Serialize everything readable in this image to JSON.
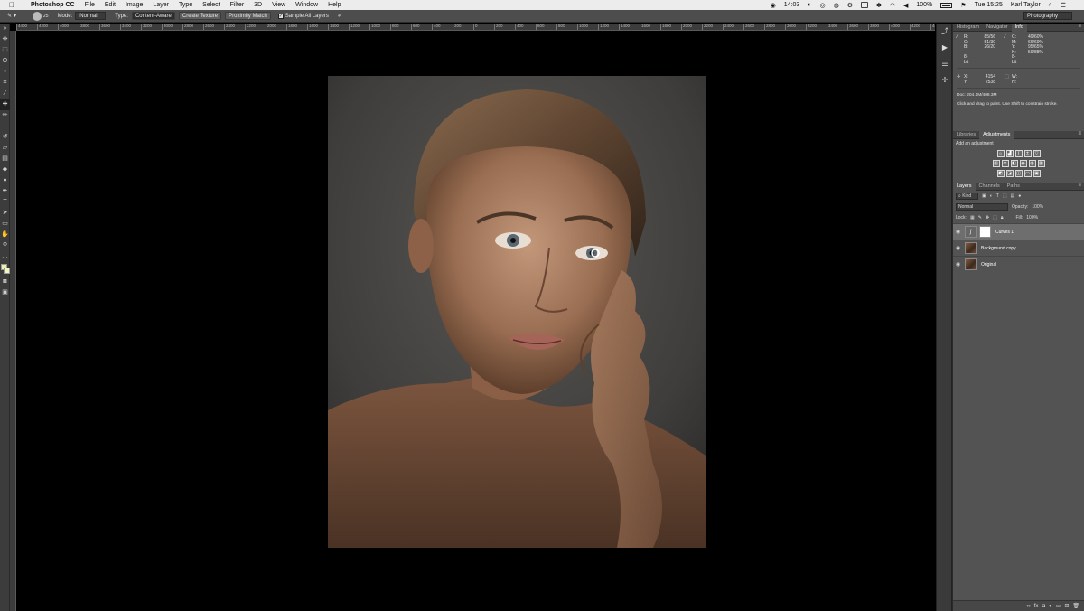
{
  "menubar": {
    "apple": "",
    "app_name": "Photoshop CC",
    "menus": [
      "File",
      "Edit",
      "Image",
      "Layer",
      "Type",
      "Select",
      "Filter",
      "3D",
      "View",
      "Window",
      "Help"
    ],
    "time_left": "14:03",
    "battery": "100%",
    "clock": "Tue 15:25",
    "user": "Karl Taylor"
  },
  "options": {
    "brush_size": "25",
    "mode_label": "Mode:",
    "mode_value": "Normal",
    "type_label": "Type:",
    "content_aware": "Content-Aware",
    "create_texture": "Create Texture",
    "proximity_match": "Proximity Match",
    "sample_all_layers": "Sample All Layers",
    "workspace": "Photography"
  },
  "ruler": {
    "ticks": [
      "4400",
      "4200",
      "4000",
      "3800",
      "3600",
      "3400",
      "3200",
      "3000",
      "2800",
      "2600",
      "2400",
      "2200",
      "2000",
      "1800",
      "1600",
      "1400",
      "1200",
      "1000",
      "800",
      "600",
      "400",
      "200",
      "0",
      "200",
      "400",
      "600",
      "800",
      "1000",
      "1200",
      "1400",
      "1600",
      "1800",
      "2000",
      "2200",
      "2400",
      "2600",
      "2800",
      "3000",
      "3200",
      "3400",
      "3600",
      "3800",
      "4000",
      "4200",
      "4400",
      "4600",
      "4800",
      "5000",
      "5200",
      "5400",
      "5600",
      "5800",
      "6000",
      "6200",
      "6400",
      "6600",
      "6800",
      "7000",
      "7200",
      "7400",
      "7600",
      "7800"
    ]
  },
  "info": {
    "tabs": [
      "Histogram",
      "Navigator",
      "Info"
    ],
    "rgb": [
      {
        "k": "R:",
        "v": "85/",
        "v2": "56"
      },
      {
        "k": "G:",
        "v": "51/",
        "v2": "30"
      },
      {
        "k": "B:",
        "v": "26/",
        "v2": "20"
      }
    ],
    "cmyk": [
      {
        "k": "C:",
        "v": "49/",
        "v2": "60%"
      },
      {
        "k": "M:",
        "v": "66/",
        "v2": "69%"
      },
      {
        "k": "Y:",
        "v": "95/",
        "v2": "65%"
      },
      {
        "k": "K:",
        "v": "59/",
        "v2": "88%"
      }
    ],
    "bit_left": "8-bit",
    "bit_right": "8-bit",
    "x_label": "X:",
    "x_value": "4154",
    "y_label": "Y:",
    "y_value": "2538",
    "w_label": "W:",
    "h_label": "H:",
    "doc": "Doc: 204.1M/408.3M",
    "hint": "Click and drag to paint. Use Shift to constrain stroke."
  },
  "adjustments": {
    "tabs": [
      "Libraries",
      "Adjustments"
    ],
    "title": "Add an adjustment"
  },
  "layers": {
    "tabs": [
      "Layers",
      "Channels",
      "Paths"
    ],
    "kind": "⌕ Kind",
    "blend_mode": "Normal",
    "opacity_label": "Opacity:",
    "opacity_value": "100%",
    "lock_label": "Lock:",
    "fill_label": "Fill:",
    "fill_value": "100%",
    "items": [
      {
        "name": "Curves 1"
      },
      {
        "name": "Background copy"
      },
      {
        "name": "Original"
      }
    ]
  }
}
